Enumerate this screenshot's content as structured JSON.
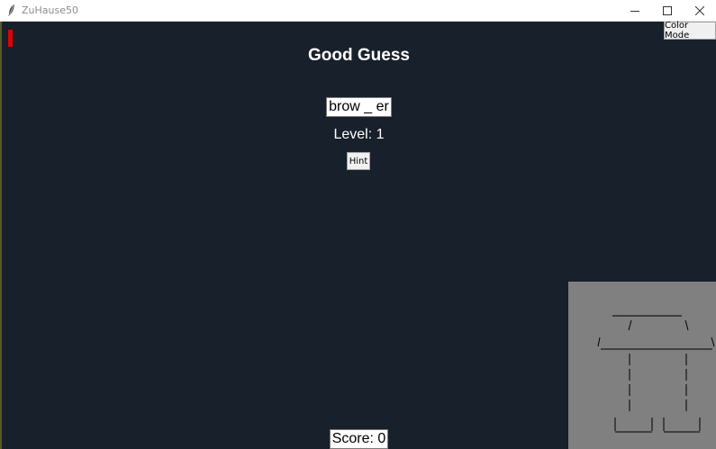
{
  "window": {
    "title": "ZuHause50",
    "controls": {
      "minimize_icon": "minimize-icon",
      "maximize_icon": "maximize-icon",
      "close_icon": "close-icon"
    }
  },
  "toolbar": {
    "color_mode_label": "Color Mode"
  },
  "game": {
    "status_message": "Good Guess",
    "masked_word": "brow _ er",
    "level_text": "Level: 1",
    "hint_label": "Hint",
    "score_text": "Score: 0"
  },
  "colors": {
    "canvas_background": "#18202b",
    "indicator_red": "#e00000",
    "gallows_panel": "#808080",
    "text_primary": "#ffffff"
  }
}
